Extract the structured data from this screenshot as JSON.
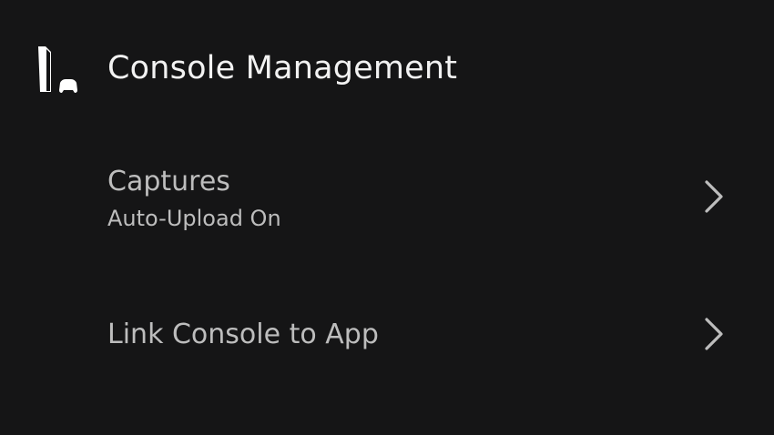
{
  "header": {
    "icon": "console-icon",
    "title": "Console Management"
  },
  "rows": [
    {
      "label": "Captures",
      "sublabel": "Auto-Upload On",
      "icon": "chevron-right-icon"
    },
    {
      "label": "Link Console to App",
      "icon": "chevron-right-icon"
    }
  ],
  "colors": {
    "background": "#151516",
    "title_text": "#f2f2f2",
    "row_text": "#bdbdbd",
    "chevron": "#bdbdbd"
  }
}
